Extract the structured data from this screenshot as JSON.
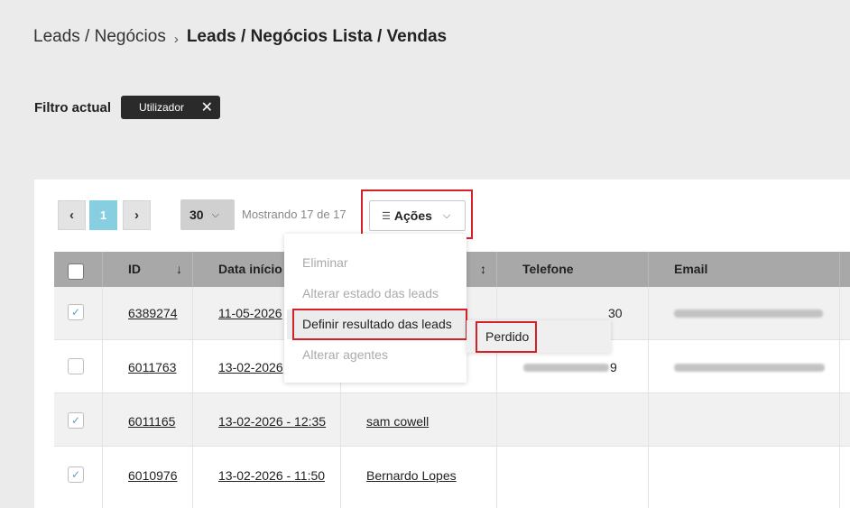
{
  "breadcrumb": {
    "link": "Leads / Negócios",
    "separator": "›",
    "current": "Leads / Negócios Lista / Vendas"
  },
  "filter": {
    "label": "Filtro actual",
    "chip_label": "Utilizador",
    "chip_remove": "✕"
  },
  "pagination": {
    "prev": "‹",
    "current": "1",
    "next": "›",
    "per_page": "30",
    "per_page_chevron": "⌵",
    "showing": "Mostrando 17 de 17"
  },
  "actions": {
    "icon": "list-icon",
    "icon_glyph": "☰",
    "label": "Ações",
    "chevron": "⌵",
    "menu": [
      {
        "label": "Eliminar",
        "enabled": false
      },
      {
        "label": "Alterar estado das leads",
        "enabled": false
      },
      {
        "label": "Definir resultado das leads",
        "enabled": true
      },
      {
        "label": "Alterar agentes",
        "enabled": false
      }
    ],
    "submenu": [
      "Perdido"
    ]
  },
  "table": {
    "columns": {
      "id": "ID",
      "id_sort": "↓",
      "date": "Data início",
      "name_sort": "↕",
      "phone": "Telefone",
      "email": "Email"
    },
    "rows": [
      {
        "checked": true,
        "id": "6389274",
        "date": "11-05-2026",
        "name": "",
        "phone_suffix": "30"
      },
      {
        "checked": false,
        "id": "6011763",
        "date": "13-02-2026",
        "name": "",
        "phone_suffix": "9"
      },
      {
        "checked": true,
        "id": "6011165",
        "date": "13-02-2026 - 12:35",
        "name": "sam cowell",
        "phone_suffix": ""
      },
      {
        "checked": true,
        "id": "6010976",
        "date": "13-02-2026 - 11:50",
        "name": "Bernardo Lopes",
        "phone_suffix": ""
      }
    ],
    "check_glyph": "✓"
  },
  "colors": {
    "highlight_border": "#d42027",
    "active_page": "#87cfe0",
    "header_bg": "#a8a8a8",
    "chip_bg": "#2a2a2a"
  }
}
